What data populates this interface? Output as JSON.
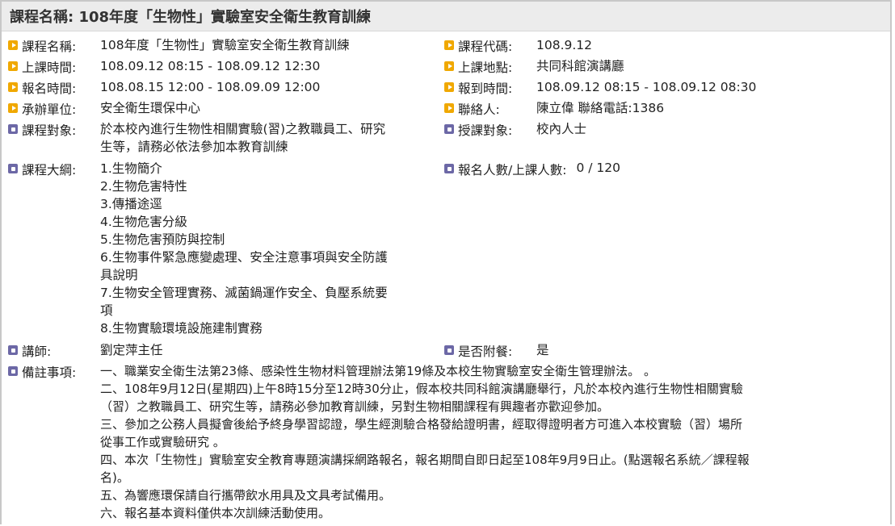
{
  "header": {
    "title": "課程名稱: 108年度「生物性」實驗室安全衛生教育訓練"
  },
  "fields": {
    "course_name": {
      "label": "課程名稱:",
      "value": "108年度「生物性」實驗室安全衛生教育訓練"
    },
    "course_code": {
      "label": "課程代碼:",
      "value": "108.9.12"
    },
    "class_time": {
      "label": "上課時間:",
      "value": "108.09.12 08:15 - 108.09.12 12:30"
    },
    "location": {
      "label": "上課地點:",
      "value": "共同科館演講廳"
    },
    "signup_time": {
      "label": "報名時間:",
      "value": "108.08.15 12:00 - 108.09.09 12:00"
    },
    "checkin_time": {
      "label": "報到時間:",
      "value": "108.09.12 08:15 - 108.09.12 08:30"
    },
    "organizer": {
      "label": "承辦單位:",
      "value": "安全衛生環保中心"
    },
    "contact": {
      "label": "聯絡人:",
      "value": "陳立偉 聯絡電話:1386"
    },
    "target": {
      "label": "課程對象:",
      "lines": [
        "於本校內進行生物性相關實驗(習)之教職員工、研究",
        "生等，請務必依法參加本教育訓練"
      ]
    },
    "audience": {
      "label": "授課對象:",
      "value": "校內人士"
    },
    "outline": {
      "label": "課程大綱:",
      "lines": [
        "1.生物簡介",
        "2.生物危害特性",
        "3.傳播途逕",
        "4.生物危害分級",
        "5.生物危害預防與控制",
        "6.生物事件緊急應變處理、安全注意事項與安全防護",
        "具說明",
        "7.生物安全管理實務、滅菌鍋運作安全、負壓系統要",
        "項",
        "8.生物實驗環境設施建制實務"
      ]
    },
    "enrollment": {
      "label": "報名人數/上課人數:",
      "value": "0 / 120"
    },
    "instructor": {
      "label": "講師:",
      "value": "劉定萍主任"
    },
    "meal": {
      "label": "是否附餐:",
      "value": "是"
    },
    "remarks": {
      "label": "備註事項:",
      "lines": [
        "一、職業安全衛生法第23條、感染性生物材料管理辦法第19條及本校生物實驗室安全衛生管理辦法。 。",
        "二、108年9月12日(星期四)上午8時15分至12時30分止，假本校共同科館演講廳舉行，凡於本校內進行生物性相關實驗",
        "（習）之教職員工、研究生等，請務必參加教育訓練，另對生物相關課程有興趣者亦歡迎參加。",
        "三、參加之公務人員擬會後給予終身學習認證，學生經測驗合格發給證明書，經取得證明者方可進入本校實驗（習）場所",
        "從事工作或實驗研究 。",
        "四、本次「生物性」實驗室安全教育專題演講採網路報名，報名期間自即日起至108年9月9日止。(點選報名系統／課程報",
        "名)。",
        "五、為響應環保請自行攜帶飲水用具及文具考試備用。",
        "六、報名基本資料僅供本次訓練活動使用。"
      ]
    }
  },
  "colors": {
    "orange_icon": "#f0a800",
    "purple_icon": "#6c68a6",
    "title_bg": "#ececec"
  }
}
